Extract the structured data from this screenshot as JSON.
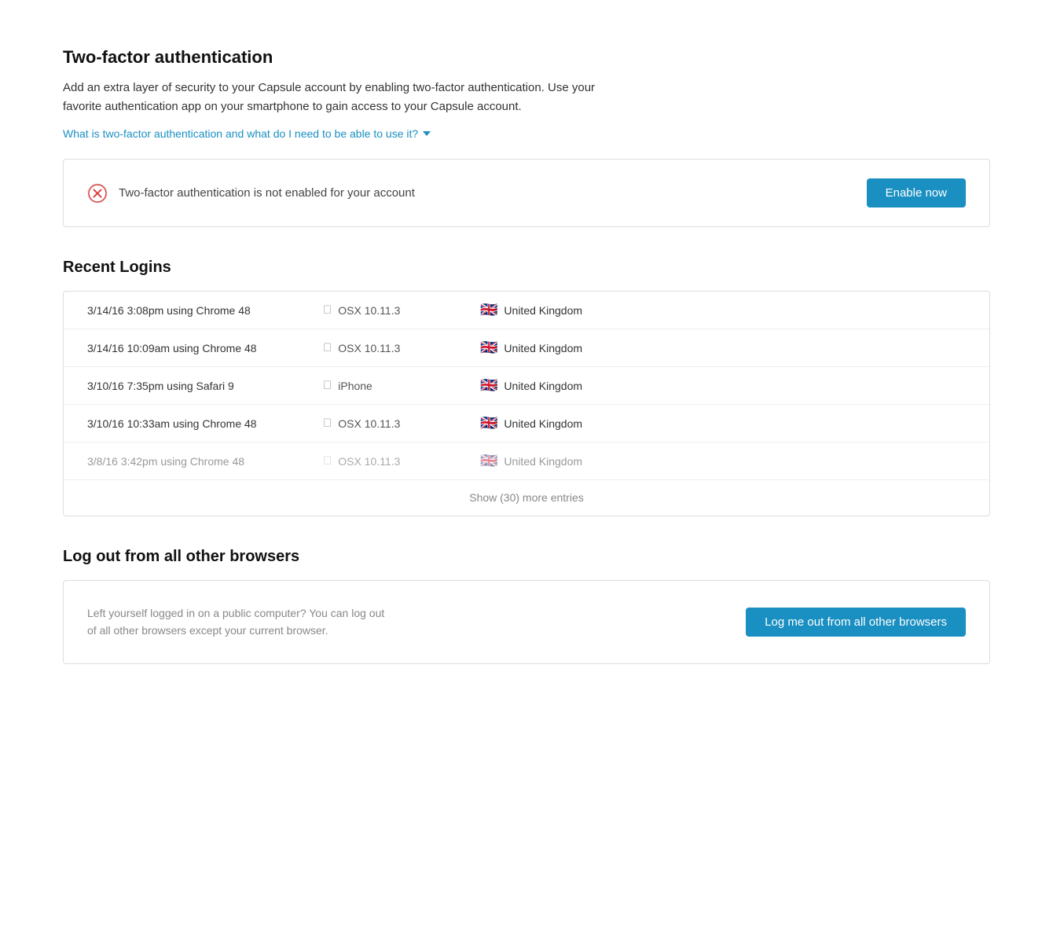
{
  "two_factor": {
    "title": "Two-factor authentication",
    "description": "Add an extra layer of security to your Capsule account by enabling two-factor authentication. Use your favorite authentication app on your smartphone to gain access to your Capsule account.",
    "faq_link": "What is two-factor authentication and what do I need to be able to use it?",
    "status_text": "Two-factor authentication is not enabled for your account",
    "enable_button": "Enable now"
  },
  "recent_logins": {
    "title": "Recent Logins",
    "show_more_label": "Show (30) more entries",
    "entries": [
      {
        "time": "3/14/16 3:08pm using Chrome 48",
        "os": "OSX 10.11.3",
        "country": "United Kingdom"
      },
      {
        "time": "3/14/16 10:09am using Chrome 48",
        "os": "OSX 10.11.3",
        "country": "United Kingdom"
      },
      {
        "time": "3/10/16 7:35pm using Safari 9",
        "os": "iPhone",
        "country": "United Kingdom"
      },
      {
        "time": "3/10/16 10:33am using Chrome 48",
        "os": "OSX 10.11.3",
        "country": "United Kingdom"
      },
      {
        "time": "3/8/16 3:42pm using Chrome 48",
        "os": "OSX 10.11.3",
        "country": "United Kingdom"
      }
    ]
  },
  "logout_section": {
    "title": "Log out from all other browsers",
    "description": "Left yourself logged in on a public computer? You can log out of all other browsers except your current browser.",
    "button_label": "Log me out from all other browsers"
  }
}
